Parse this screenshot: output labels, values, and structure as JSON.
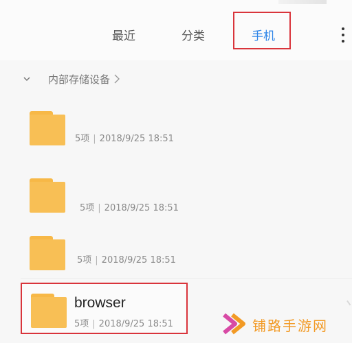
{
  "tabs": [
    {
      "label": "最近"
    },
    {
      "label": "分类"
    },
    {
      "label": "手机"
    }
  ],
  "breadcrumb": {
    "label": "内部存储设备"
  },
  "folders": [
    {
      "name": "",
      "count": "5项",
      "date": "2018/9/25 18:51"
    },
    {
      "name": "",
      "count": "5项",
      "date": "2018/9/25 18:51"
    },
    {
      "name": "",
      "count": "5项",
      "date": "2018/9/25 18:51"
    },
    {
      "name": "browser",
      "count": "5项",
      "date": "2018/9/25 18:51"
    }
  ],
  "watermark": {
    "text": "铺路手游网"
  },
  "icons": {
    "more": "more-vertical-icon",
    "folder": "folder-icon",
    "chevron_down": "chevron-down-icon",
    "chevron_right": "chevron-right-icon",
    "watermark_logo": "double-arrow-logo"
  },
  "colors": {
    "accent": "#2f86e8",
    "highlight": "#d9343b",
    "folder": "#f8bf55",
    "watermark": "#f29a25"
  }
}
